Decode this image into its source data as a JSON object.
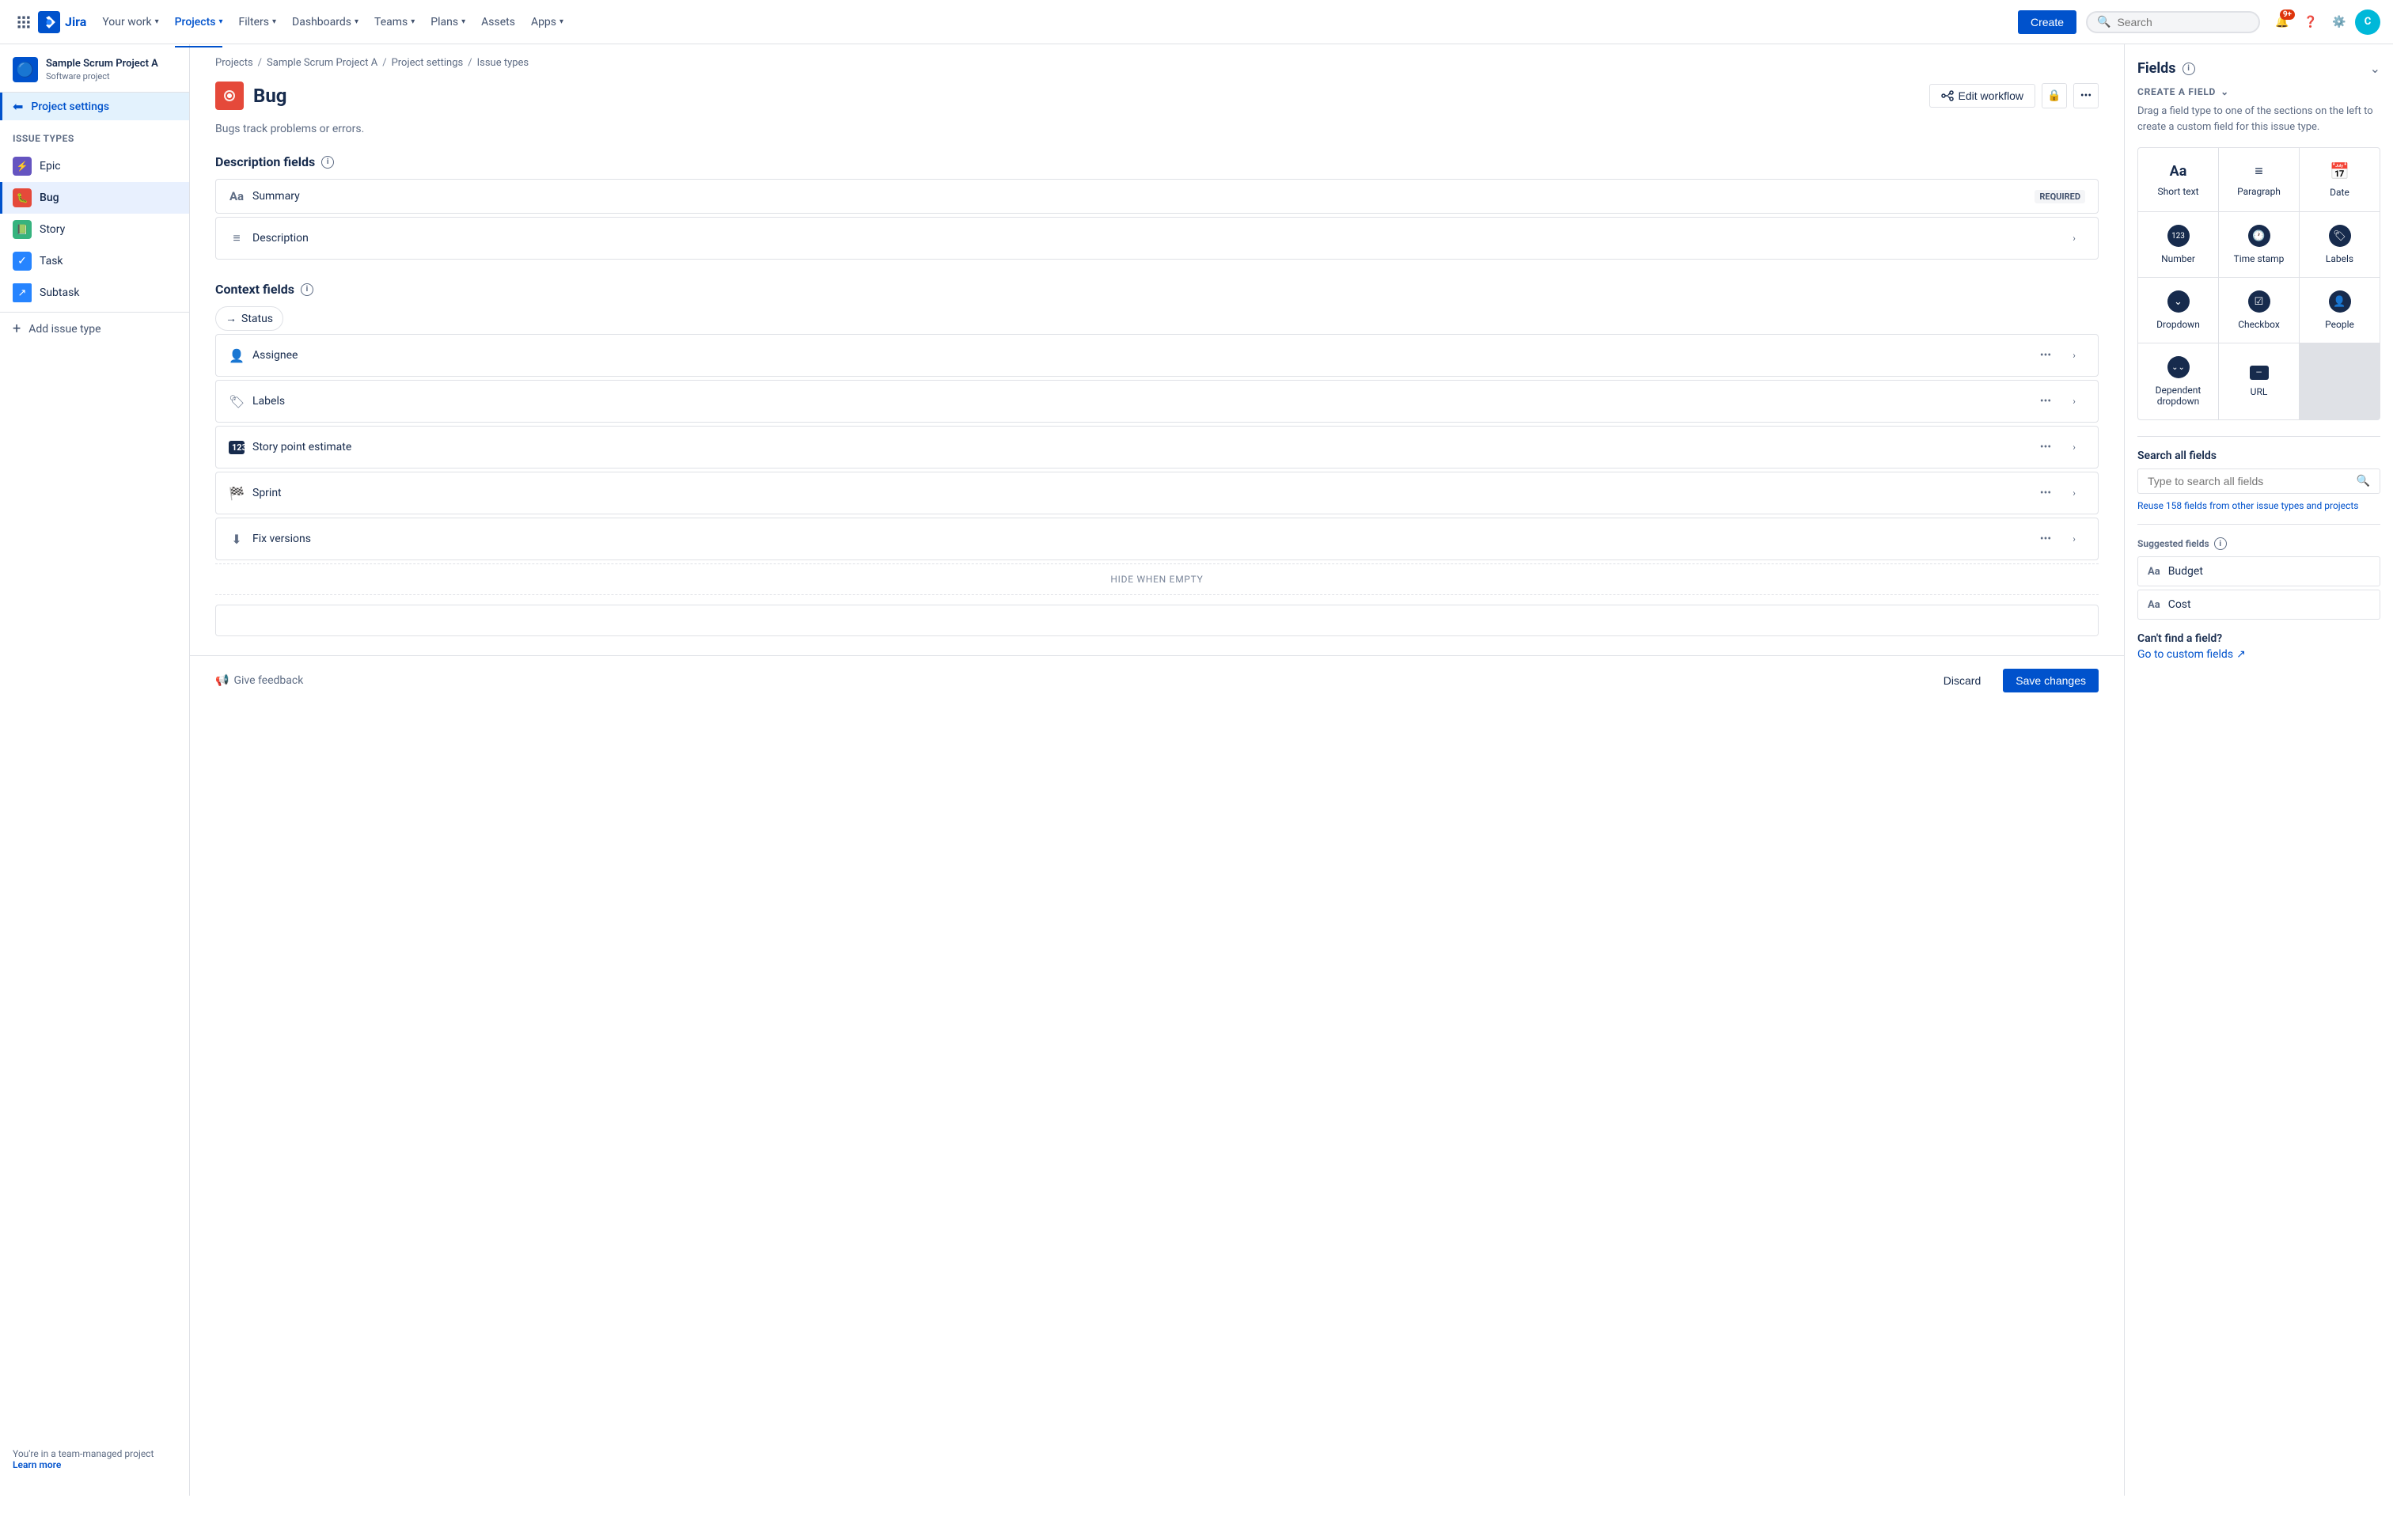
{
  "topnav": {
    "logo_text": "Jira",
    "your_work": "Your work",
    "projects": "Projects",
    "filters": "Filters",
    "dashboards": "Dashboards",
    "teams": "Teams",
    "plans": "Plans",
    "assets": "Assets",
    "apps": "Apps",
    "create": "Create",
    "search_placeholder": "Search",
    "notification_count": "9+",
    "avatar_initials": "C"
  },
  "sidebar": {
    "project_name": "Sample Scrum Project A",
    "project_type": "Software project",
    "project_settings_label": "Project settings",
    "section_title": "Issue types",
    "issue_types": [
      {
        "id": "epic",
        "label": "Epic",
        "icon_class": "icon-epic",
        "icon_char": "⚡"
      },
      {
        "id": "bug",
        "label": "Bug",
        "icon_class": "icon-bug",
        "icon_char": "🐛",
        "active": true
      },
      {
        "id": "story",
        "label": "Story",
        "icon_class": "icon-story",
        "icon_char": "📗"
      },
      {
        "id": "task",
        "label": "Task",
        "icon_class": "icon-task",
        "icon_char": "✓"
      },
      {
        "id": "subtask",
        "label": "Subtask",
        "icon_class": "icon-subtask",
        "icon_char": "↗"
      }
    ],
    "add_issue_type": "Add issue type",
    "footer_text": "You're in a team-managed project",
    "learn_more": "Learn more"
  },
  "breadcrumb": {
    "items": [
      "Projects",
      "Sample Scrum Project A",
      "Project settings",
      "Issue types"
    ],
    "separators": [
      "/",
      "/",
      "/"
    ]
  },
  "page": {
    "title": "Bug",
    "description": "Bugs track problems or errors.",
    "edit_workflow": "Edit workflow",
    "description_fields_title": "Description fields",
    "context_fields_title": "Context fields",
    "hide_when_empty": "HIDE WHEN EMPTY",
    "fields": {
      "description": [
        {
          "id": "summary",
          "name": "Summary",
          "icon": "Aa",
          "required": true,
          "required_label": "REQUIRED"
        },
        {
          "id": "description",
          "name": "Description",
          "icon": "≡"
        }
      ],
      "context": [
        {
          "id": "status",
          "name": "Status",
          "type": "chip"
        },
        {
          "id": "assignee",
          "name": "Assignee",
          "icon": "👤"
        },
        {
          "id": "labels",
          "name": "Labels",
          "icon": "🏷"
        },
        {
          "id": "story_point",
          "name": "Story point estimate",
          "icon": "123"
        },
        {
          "id": "sprint",
          "name": "Sprint",
          "icon": "⚙"
        },
        {
          "id": "fix_versions",
          "name": "Fix versions",
          "icon": "⬇"
        }
      ]
    }
  },
  "footer": {
    "feedback": "Give feedback",
    "discard": "Discard",
    "save_changes": "Save changes"
  },
  "right_panel": {
    "title": "Fields",
    "create_field_label": "CREATE A FIELD",
    "create_field_desc": "Drag a field type to one of the sections on the left to create a custom field for this issue type.",
    "field_types": [
      {
        "id": "short_text",
        "label": "Short text",
        "icon_type": "text",
        "icon_char": "Aa"
      },
      {
        "id": "paragraph",
        "label": "Paragraph",
        "icon_type": "lines",
        "icon_char": "≡"
      },
      {
        "id": "date",
        "label": "Date",
        "icon_type": "cal",
        "icon_char": "📅"
      },
      {
        "id": "number",
        "label": "Number",
        "icon_type": "circle",
        "icon_char": "123"
      },
      {
        "id": "time_stamp",
        "label": "Time stamp",
        "icon_type": "circle",
        "icon_char": "🕐"
      },
      {
        "id": "labels",
        "label": "Labels",
        "icon_type": "tag",
        "icon_char": "🏷"
      },
      {
        "id": "dropdown",
        "label": "Dropdown",
        "icon_type": "circle",
        "icon_char": "⌄"
      },
      {
        "id": "checkbox",
        "label": "Checkbox",
        "icon_type": "circle",
        "icon_char": "☑"
      },
      {
        "id": "people",
        "label": "People",
        "icon_type": "circle",
        "icon_char": "👤"
      },
      {
        "id": "dependent_dropdown",
        "label": "Dependent dropdown",
        "icon_type": "circle",
        "icon_char": "⌄⌄"
      },
      {
        "id": "url",
        "label": "URL",
        "icon_type": "rect",
        "icon_char": "—"
      }
    ],
    "search_label": "Search all fields",
    "search_placeholder": "Type to search all fields",
    "reuse_text": "Reuse 158 fields from other issue types and projects",
    "suggested_label": "Suggested fields",
    "suggested_fields": [
      {
        "id": "budget",
        "label": "Budget",
        "icon": "Aa"
      },
      {
        "id": "cost",
        "label": "Cost",
        "icon": "Aa"
      }
    ],
    "cant_find": "Can't find a field?",
    "go_custom": "Go to custom fields"
  }
}
